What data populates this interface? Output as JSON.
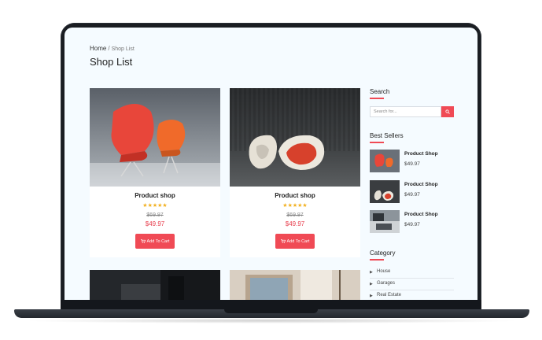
{
  "breadcrumb": {
    "home": "Home",
    "separator": "/",
    "current": "Shop List"
  },
  "page_title": "Shop List",
  "products": [
    {
      "name": "Product shop",
      "rating": 5,
      "stars": "★★★★★",
      "old_price": "$69.97",
      "price": "$49.97",
      "button": "Add To Cart"
    },
    {
      "name": "Product shop",
      "rating": 5,
      "stars": "★★★★★",
      "old_price": "$69.97",
      "price": "$49.97",
      "button": "Add To Cart"
    }
  ],
  "sidebar": {
    "search": {
      "heading": "Search",
      "placeholder": "Search for..."
    },
    "best_sellers": {
      "heading": "Best Sellers",
      "items": [
        {
          "name": "Product Shop",
          "price": "$49.97"
        },
        {
          "name": "Product Shop",
          "price": "$49.97"
        },
        {
          "name": "Product Shop",
          "price": "$49.97"
        }
      ]
    },
    "category": {
      "heading": "Category",
      "items": [
        "House",
        "Garages",
        "Real Estate"
      ]
    }
  },
  "colors": {
    "accent": "#f04a55",
    "price": "#e8404f",
    "star": "#f2b01e",
    "background": "#f5fbff"
  },
  "icons": {
    "search": "search-icon",
    "cart": "cart-icon",
    "caret": "caret-right-icon"
  }
}
